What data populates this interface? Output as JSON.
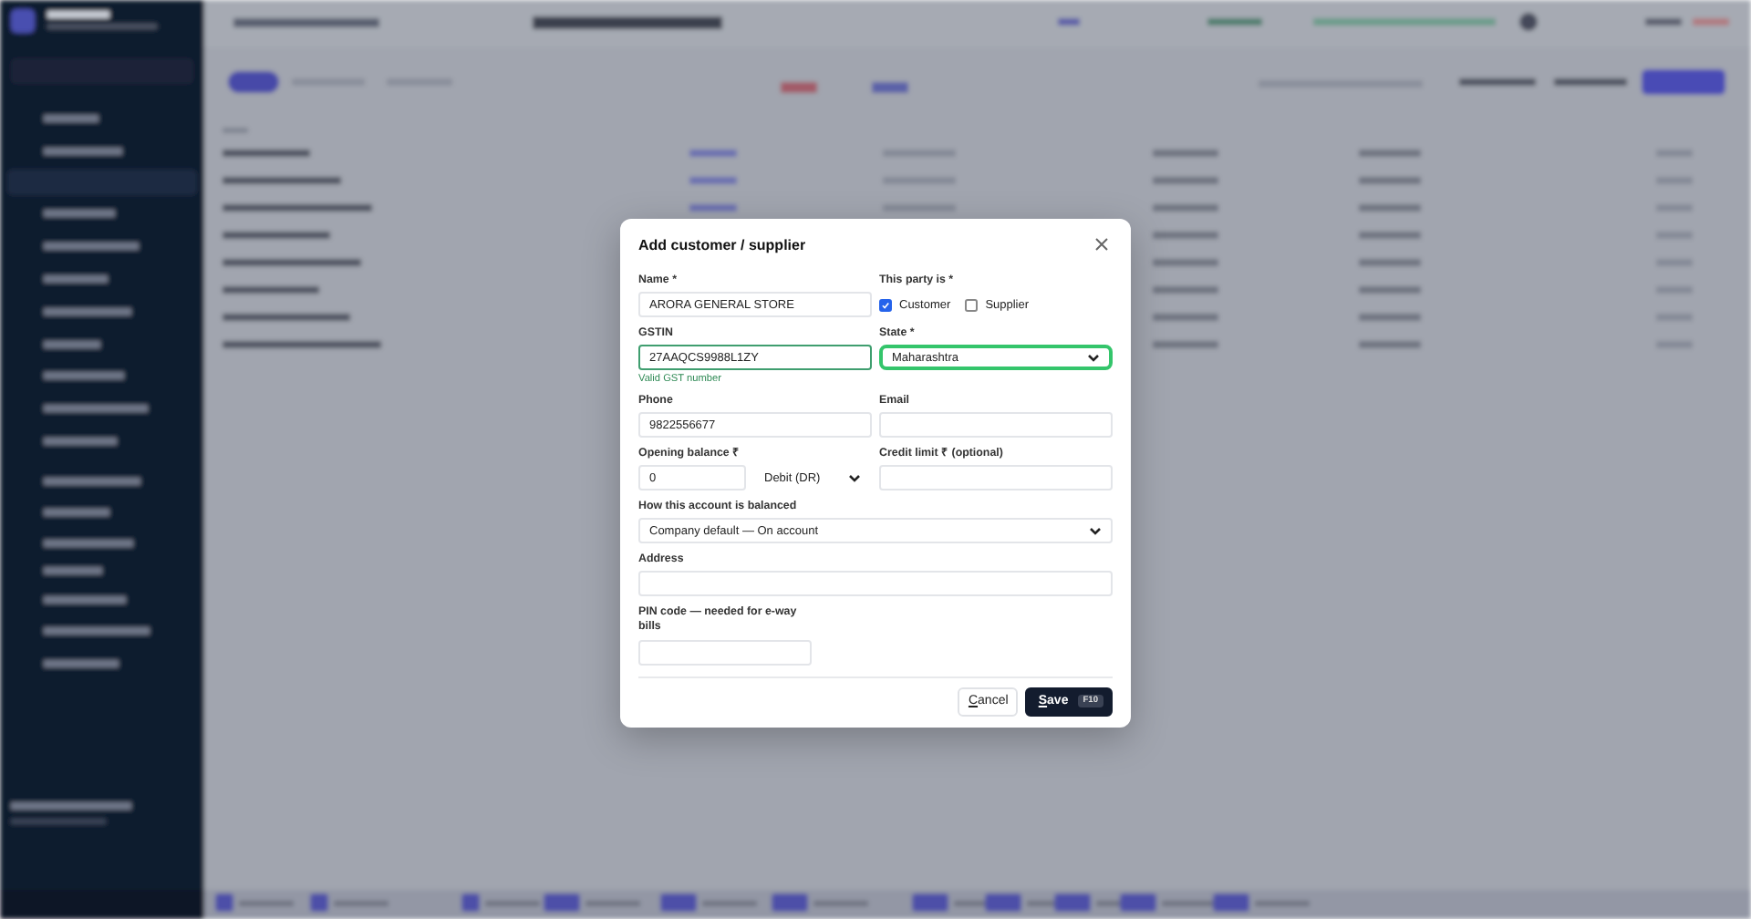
{
  "dialog": {
    "title": "Add customer / supplier",
    "rows": [
      [
        {
          "kind": "text",
          "label": "Name *",
          "value": "ARORA GENERAL STORE"
        },
        {
          "kind": "checks",
          "label": "This party is *",
          "options": [
            {
              "label": "Customer",
              "checked": true
            },
            {
              "label": "Supplier",
              "checked": false
            }
          ]
        }
      ],
      [
        {
          "kind": "text",
          "label": "GSTIN",
          "value": "27AAQCS9988L1ZY",
          "hint": "Valid GST number",
          "valid": true
        },
        {
          "kind": "select",
          "label": "State *",
          "value": "Maharashtra",
          "focused": true
        }
      ],
      [
        {
          "kind": "text",
          "label": "Phone",
          "value": "9822556677"
        },
        {
          "kind": "text",
          "label": "Email"
        }
      ],
      [
        {
          "kind": "amount",
          "label": "Opening balance ₹",
          "value": "0",
          "side": "Debit (DR)"
        },
        {
          "kind": "text",
          "label": "Credit limit ₹ (optional)"
        }
      ],
      [
        {
          "kind": "select",
          "label": "How this account is balanced",
          "value": "Company default — On account",
          "focused": false
        }
      ],
      [
        {
          "kind": "text",
          "label": "Address"
        }
      ],
      [
        {
          "kind": "short_text",
          "label": "PIN code — needed for e-way bills"
        }
      ]
    ],
    "buttons": [
      {
        "label": "Cancel",
        "kind": "secondary",
        "mnemonic": true
      },
      {
        "label": "Save",
        "kind": "primary",
        "mnemonic": true,
        "shortcut": "F10"
      }
    ]
  }
}
